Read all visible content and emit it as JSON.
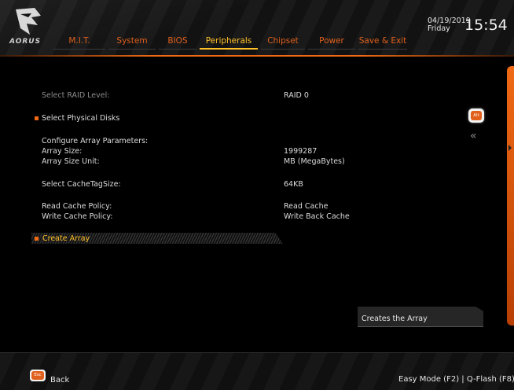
{
  "header": {
    "brand": "AORUS",
    "tabs": [
      {
        "label": "M.I.T.",
        "active": false
      },
      {
        "label": "System",
        "active": false
      },
      {
        "label": "BIOS",
        "active": false
      },
      {
        "label": "Peripherals",
        "active": true
      },
      {
        "label": "Chipset",
        "active": false
      },
      {
        "label": "Power",
        "active": false
      },
      {
        "label": "Save & Exit",
        "active": false
      }
    ],
    "date": "04/19/2019",
    "day": "Friday",
    "time": "15:54"
  },
  "main": {
    "select_raid_level": {
      "label": "Select RAID Level:",
      "value": "RAID 0"
    },
    "select_physical_disks": "Select Physical Disks",
    "configure_array_params": "Configure Array Parameters:",
    "array_size": {
      "label": "Array Size:",
      "value": "1999287"
    },
    "array_size_unit": {
      "label": "Array Size Unit:",
      "value": "MB (MegaBytes)"
    },
    "cache_tag_size": {
      "label": "Select CacheTagSize:",
      "value": "64KB"
    },
    "read_cache_policy": {
      "label": "Read Cache Policy:",
      "value": "Read Cache"
    },
    "write_cache_policy": {
      "label": "Write Cache Policy:",
      "value": "Write Back Cache"
    },
    "create_array": "Create Array",
    "alt_key": "Alt",
    "double_chevron": "«"
  },
  "help": {
    "text": "Creates the Array"
  },
  "footer": {
    "esc_key": "Esc",
    "back": "Back",
    "right_text": "Easy Mode (F2)  |  Q-Flash (F8)"
  },
  "colors": {
    "accent": "#f06a14",
    "active_tab": "#ffc02a",
    "tab": "#e0601c",
    "background": "#000000"
  }
}
